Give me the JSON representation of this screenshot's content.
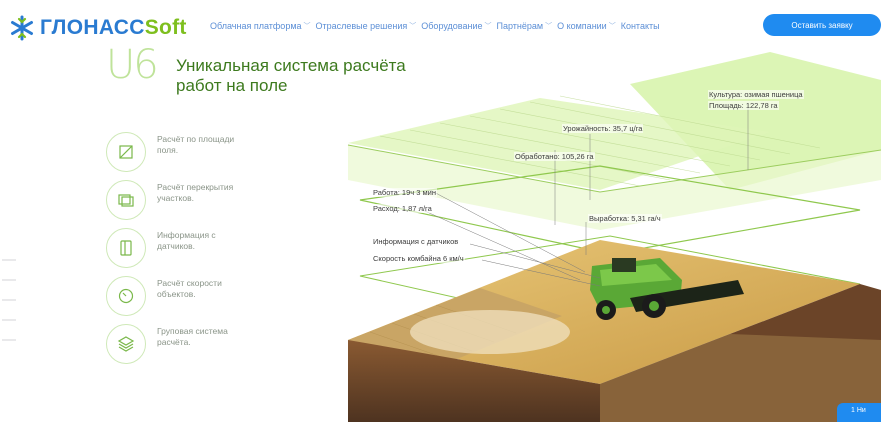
{
  "brand": {
    "name_part1": "ГЛОНАСС",
    "name_part2": "Soft"
  },
  "nav": [
    {
      "label": "Облачная платформа",
      "chevron": "chevron-down"
    },
    {
      "label": "Отраслевые решения",
      "chevron": "chevron-down"
    },
    {
      "label": "Оборудование",
      "chevron": "chevron-down"
    },
    {
      "label": "Партнёрам",
      "chevron": "chevron-down"
    },
    {
      "label": "О компании",
      "chevron": "chevron-down"
    },
    {
      "label": "Контакты"
    }
  ],
  "cta_label": "Оставить заявку",
  "hero": {
    "badge": "U6",
    "title_line1": "Уникальная система расчёта",
    "title_line2": "работ на поле"
  },
  "features": [
    {
      "icon": "area-calc-icon",
      "line1": "Расчёт по площади",
      "line2": "поля."
    },
    {
      "icon": "overlap-icon",
      "line1": "Расчёт перекрытия",
      "line2": "участков."
    },
    {
      "icon": "sensor-icon",
      "line1": "Информация с",
      "line2": "датчиков."
    },
    {
      "icon": "speedometer-icon",
      "line1": "Расчёт скорости",
      "line2": "объектов."
    },
    {
      "icon": "layers-icon",
      "line1": "Груповая система",
      "line2": "расчёта."
    }
  ],
  "scene_labels": {
    "culture": "Культура: озимая пшеница",
    "area": "Площадь: 122,78 га",
    "yield": "Урожайность: 35,7 ц/га",
    "processed": "Обработано: 105,26 га",
    "work": "Работа: 19ч 3 мин",
    "consumption": "Расход: 1,87 л/га",
    "output": "Выработка: 5,31 га/ч",
    "sensors": "Информация с датчиков",
    "speed": "Скорость комбайна 6 км/ч"
  },
  "corner_button": "1 Ни",
  "colors": {
    "brand_blue": "#2a7bd1",
    "brand_green": "#7ebf1e",
    "accent_button": "#1f8bf0",
    "layer_green": "#c8ef94",
    "wheat": "#d9b15c"
  }
}
